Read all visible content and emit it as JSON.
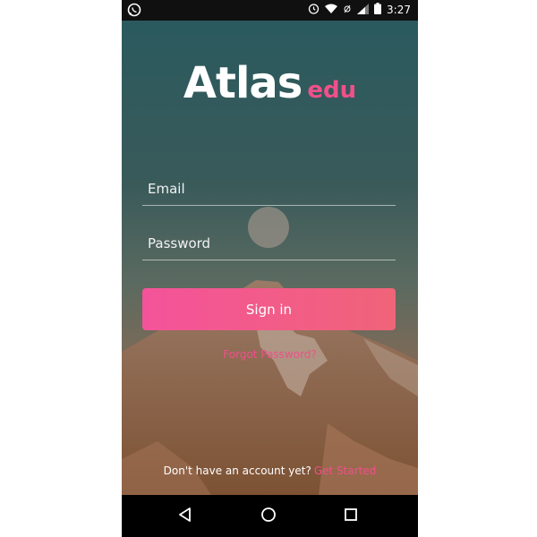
{
  "status_bar": {
    "time": "3:27",
    "icons": [
      "whatsapp-icon",
      "alarm-icon",
      "wifi-icon",
      "data-icon",
      "signal-icon",
      "battery-icon"
    ]
  },
  "logo": {
    "primary": "Atlas",
    "secondary": "edu"
  },
  "form": {
    "email_placeholder": "Email",
    "password_placeholder": "Password",
    "signin_label": "Sign in",
    "forgot_label": "Forgot Password?"
  },
  "footer": {
    "prompt": "Don't have an account yet?",
    "link": "Get Started"
  },
  "nav": {
    "icons": [
      "back-icon",
      "home-icon",
      "recents-icon"
    ]
  },
  "colors": {
    "accent": "#f0508a",
    "button_start": "#f4539a",
    "button_end": "#f06478"
  }
}
